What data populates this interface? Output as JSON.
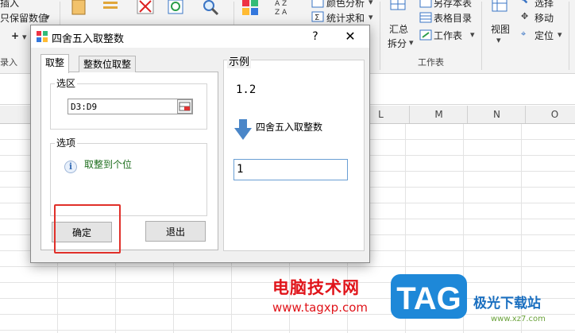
{
  "ribbon": {
    "item_top_a": "插入",
    "item_keep_value": "只保留数值",
    "item_plus": "+",
    "group_left": "录入",
    "item_color_analysis": "颜色分析",
    "item_stats": "统计求和",
    "item_summary_a": "汇总",
    "item_summary_b": "拆分",
    "item_save_table": "另存本表",
    "item_table_index": "表格目录",
    "item_sheet": "工作表",
    "group_sheet": "工作表",
    "item_view": "视图",
    "item_select": "选择",
    "item_move": "移动",
    "item_locate": "定位"
  },
  "columns": [
    "L",
    "M",
    "N",
    "O"
  ],
  "dialog": {
    "title": "四舍五入取整数",
    "help": "?",
    "close": "✕",
    "tabs": [
      "取整",
      "整数位取整"
    ],
    "range_group": "选区",
    "range_value": "D3:D9",
    "options_group": "选项",
    "option_text": "取整到个位",
    "ok_label": "确定",
    "exit_label": "退出",
    "example_label": "示例",
    "example_value": "1.2",
    "arrow_label": "四舍五入取整数",
    "result_value": "1"
  },
  "watermark": {
    "cn": "电脑技术网",
    "url": "www.tagxp.com",
    "tag": "TAG",
    "site": "极光下载站",
    "site_url": "www.xz7.com"
  },
  "colors": {
    "accent_red": "#e0302a",
    "tag_blue": "#1e88d8",
    "option_green": "#1e6e1e"
  }
}
